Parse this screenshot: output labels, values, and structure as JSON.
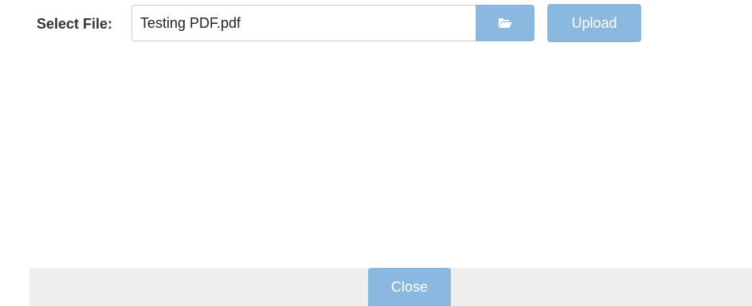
{
  "upload": {
    "label": "Select File:",
    "file_value": "Testing PDF.pdf",
    "browse_icon": "folder-open-icon",
    "upload_label": "Upload"
  },
  "footer": {
    "close_label": "Close"
  },
  "colors": {
    "button_bg": "#8ab8df",
    "footer_bg": "#eeeeee",
    "label_text": "#333333"
  }
}
